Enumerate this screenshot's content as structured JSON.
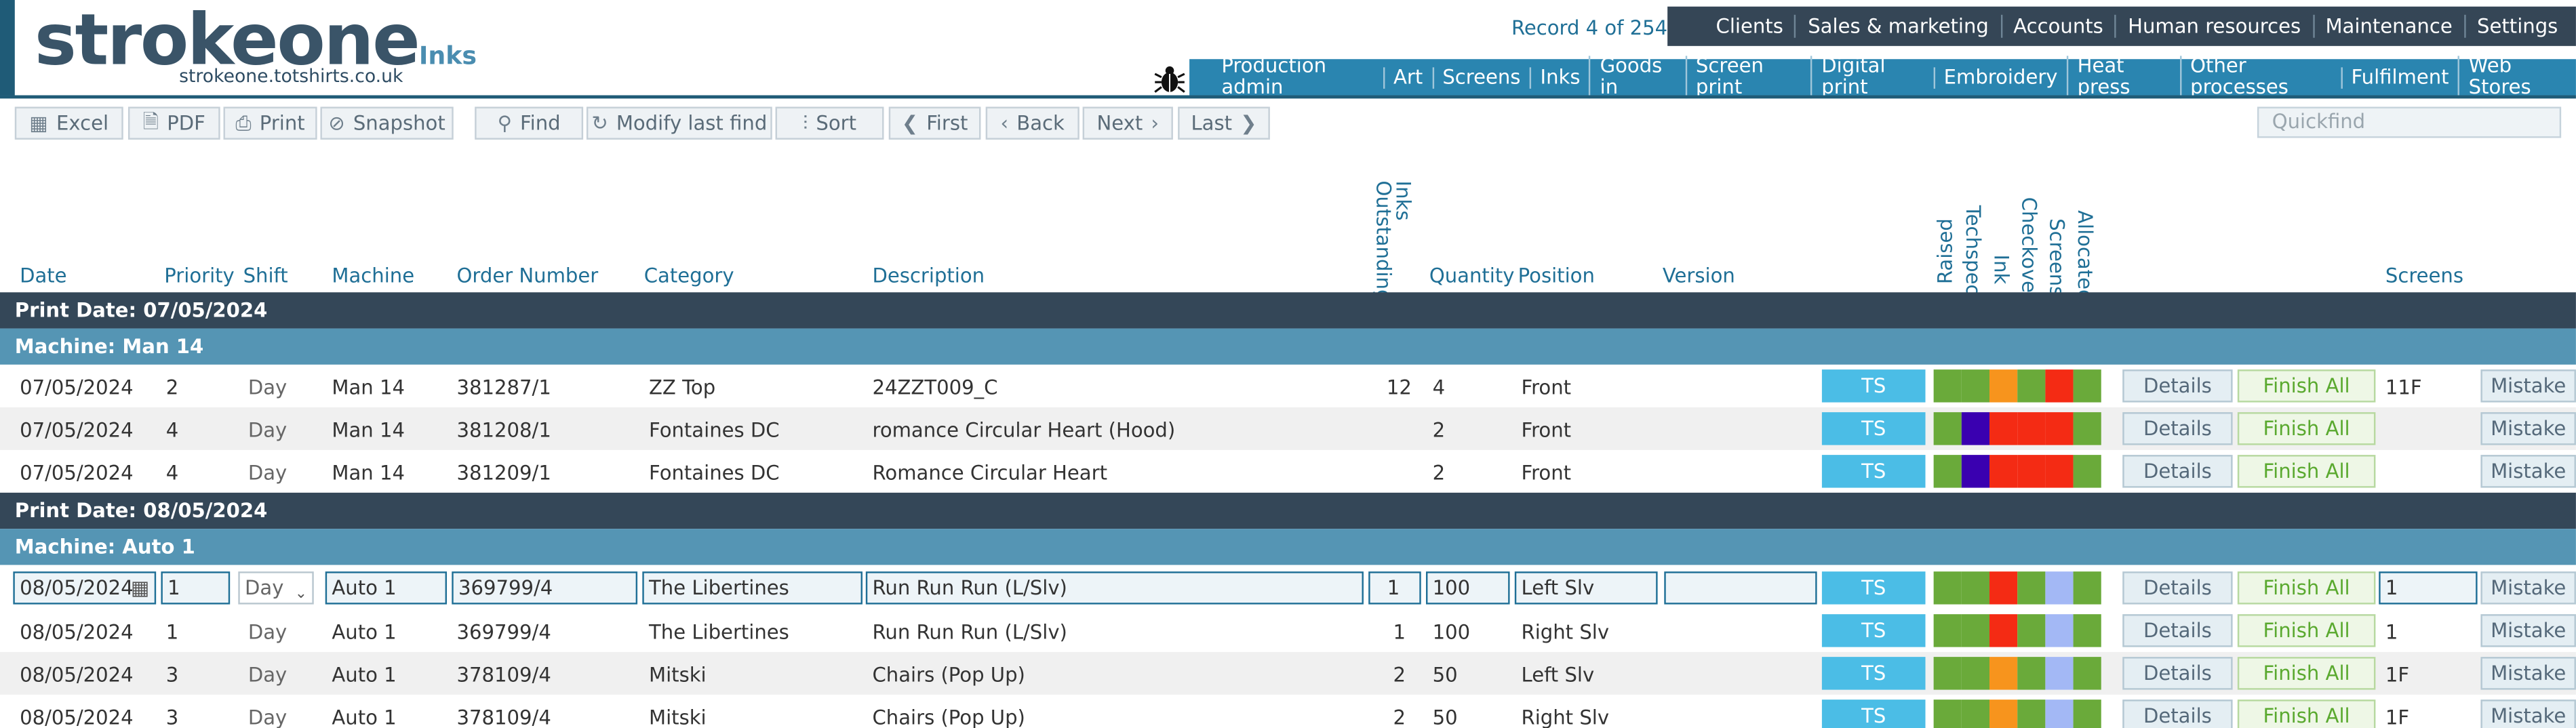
{
  "header": {
    "logo_text": "strokeone",
    "logo_url": "strokeone.totshirts.co.uk",
    "app_name": "Inks",
    "record_text": "Record 4 of 254",
    "bug_icon": "bug-icon"
  },
  "top_nav": [
    "Clients",
    "Sales & marketing",
    "Accounts",
    "Human resources",
    "Maintenance",
    "Settings"
  ],
  "sub_nav": [
    "Production admin",
    "Art",
    "Screens",
    "Inks",
    "Goods in",
    "Screen print",
    "Digital print",
    "Embroidery",
    "Heat press",
    "Other processes",
    "Fulfilment",
    "Web Stores"
  ],
  "toolbar": {
    "excel": "Excel",
    "pdf": "PDF",
    "print": "Print",
    "snapshot": "Snapshot",
    "find": "Find",
    "modify": "Modify last find",
    "sort": "Sort",
    "first": "First",
    "back": "Back",
    "next": "Next",
    "last": "Last",
    "quickfind_placeholder": "Quickfind"
  },
  "columns": {
    "date": "Date",
    "priority": "Priority",
    "shift": "Shift",
    "machine": "Machine",
    "order_number": "Order Number",
    "category": "Category",
    "description": "Description",
    "inks_outstanding": "Inks Outstanding",
    "quantity": "Quantity",
    "position": "Position",
    "version": "Version",
    "raised": "Raised",
    "techspec": "Techspec",
    "ink": "Ink",
    "checkover": "Checkover",
    "screens_status": "Screens",
    "allocated": "Allocated",
    "screens": "Screens"
  },
  "colors": {
    "green": "#6aaa3a",
    "purple": "#3a00b0",
    "orange": "#f7941d",
    "red": "#f42b14",
    "lightblue": "#a3b8f5"
  },
  "groups": [
    {
      "date_label": "Print Date: 07/05/2024",
      "machine_label": "Machine: Man 14"
    },
    {
      "date_label": "Print Date: 08/05/2024",
      "machine_label": "Machine: Auto 1"
    }
  ],
  "rows": [
    {
      "date": "07/05/2024",
      "priority": "2",
      "shift": "Day",
      "machine": "Man 14",
      "order": "381287/1",
      "category": "ZZ Top",
      "description": "24ZZT009_C",
      "inks": "12",
      "quantity": "4",
      "position": "Front",
      "version": "",
      "ts": "TS",
      "status": [
        "green",
        "green",
        "orange",
        "green",
        "red",
        "green"
      ],
      "details": "Details",
      "finish": "Finish All",
      "screens": "11F",
      "mistake": "Mistake"
    },
    {
      "date": "07/05/2024",
      "priority": "4",
      "shift": "Day",
      "machine": "Man 14",
      "order": "381208/1",
      "category": "Fontaines DC",
      "description": "romance Circular Heart (Hood)",
      "inks": "",
      "quantity": "2",
      "position": "Front",
      "version": "",
      "ts": "TS",
      "status": [
        "green",
        "purple",
        "red",
        "red",
        "red",
        "green"
      ],
      "details": "Details",
      "finish": "Finish All",
      "screens": "",
      "mistake": "Mistake"
    },
    {
      "date": "07/05/2024",
      "priority": "4",
      "shift": "Day",
      "machine": "Man 14",
      "order": "381209/1",
      "category": "Fontaines DC",
      "description": "Romance Circular Heart",
      "inks": "",
      "quantity": "2",
      "position": "Front",
      "version": "",
      "ts": "TS",
      "status": [
        "green",
        "purple",
        "red",
        "red",
        "red",
        "green"
      ],
      "details": "Details",
      "finish": "Finish All",
      "screens": "",
      "mistake": "Mistake"
    },
    {
      "date": "08/05/2024",
      "priority": "1",
      "shift": "Day",
      "machine": "Auto 1",
      "order": "369799/4",
      "category": "The Libertines",
      "description": "Run Run Run (L/Slv)",
      "inks": "1",
      "quantity": "100",
      "position": "Left Slv",
      "version": "",
      "ts": "TS",
      "status": [
        "green",
        "green",
        "red",
        "green",
        "lightblue",
        "green"
      ],
      "details": "Details",
      "finish": "Finish All",
      "screens": "1",
      "mistake": "Mistake"
    },
    {
      "date": "08/05/2024",
      "priority": "1",
      "shift": "Day",
      "machine": "Auto 1",
      "order": "369799/4",
      "category": "The Libertines",
      "description": "Run Run Run (L/Slv)",
      "inks": "1",
      "quantity": "100",
      "position": "Right Slv",
      "version": "",
      "ts": "TS",
      "status": [
        "green",
        "green",
        "red",
        "green",
        "lightblue",
        "green"
      ],
      "details": "Details",
      "finish": "Finish All",
      "screens": "1",
      "mistake": "Mistake"
    },
    {
      "date": "08/05/2024",
      "priority": "3",
      "shift": "Day",
      "machine": "Auto 1",
      "order": "378109/4",
      "category": "Mitski",
      "description": "Chairs (Pop Up)",
      "inks": "2",
      "quantity": "50",
      "position": "Left Slv",
      "version": "",
      "ts": "TS",
      "status": [
        "green",
        "green",
        "orange",
        "green",
        "lightblue",
        "green"
      ],
      "details": "Details",
      "finish": "Finish All",
      "screens": "1F",
      "mistake": "Mistake"
    },
    {
      "date": "08/05/2024",
      "priority": "3",
      "shift": "Day",
      "machine": "Auto 1",
      "order": "378109/4",
      "category": "Mitski",
      "description": "Chairs (Pop Up)",
      "inks": "2",
      "quantity": "50",
      "position": "Right Slv",
      "version": "",
      "ts": "TS",
      "status": [
        "green",
        "green",
        "orange",
        "green",
        "lightblue",
        "green"
      ],
      "details": "Details",
      "finish": "Finish All",
      "screens": "1F",
      "mistake": "Mistake"
    }
  ]
}
